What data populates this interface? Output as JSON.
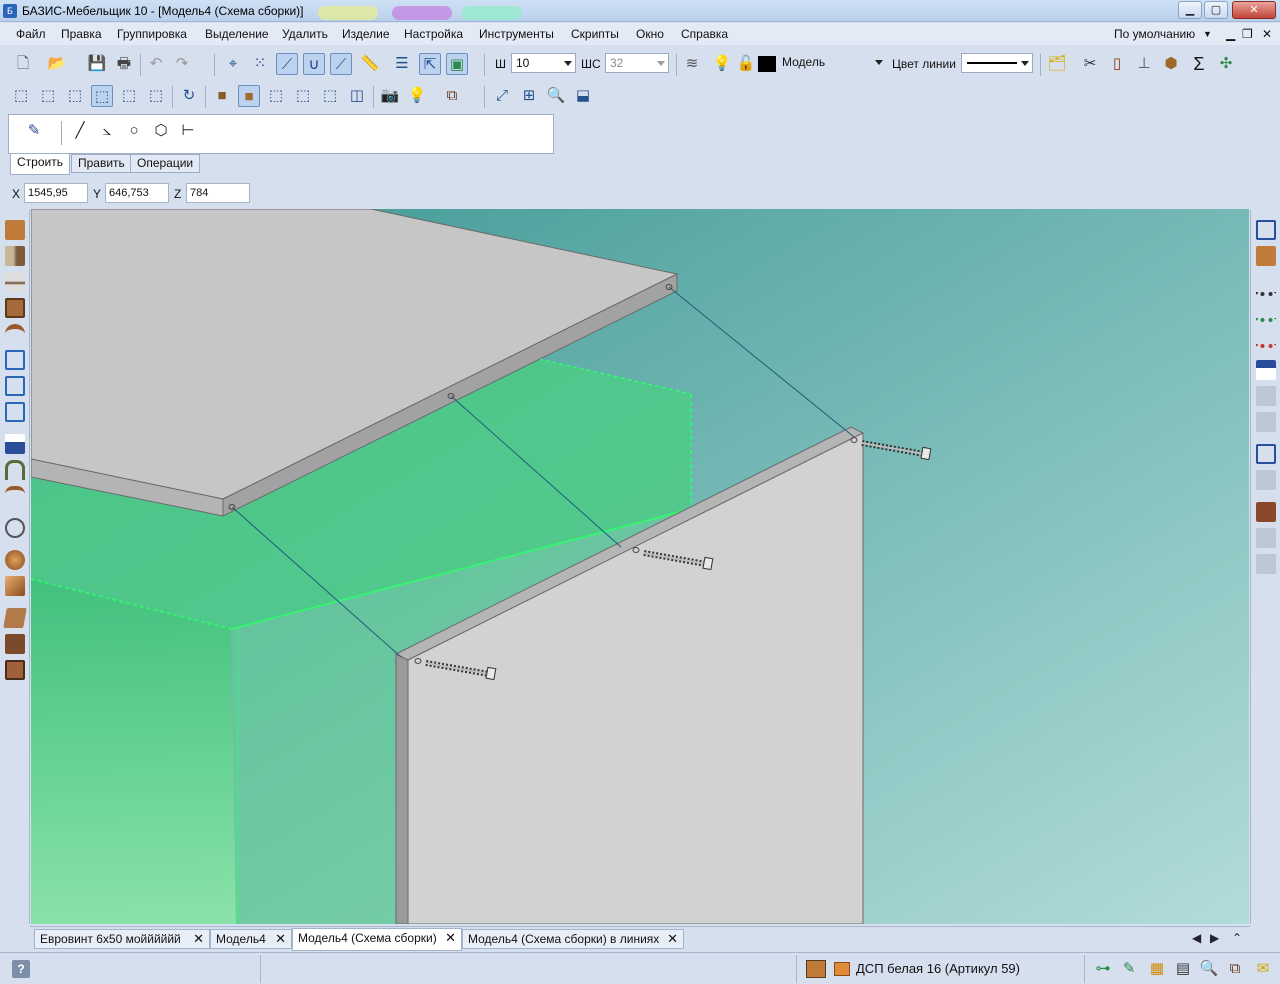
{
  "window": {
    "title": "БАЗИС-Мебельщик 10 - [Модель4 (Схема сборки)]",
    "min": "▁",
    "max": "▢",
    "close": "✕"
  },
  "menu": {
    "items": [
      "Файл",
      "Правка",
      "Группировка",
      "Выделение",
      "Удалить",
      "Изделие",
      "Настройка",
      "Инструменты",
      "Скрипты",
      "Окно",
      "Справка"
    ],
    "profile": "По умолчанию",
    "mdi_min": "▁",
    "mdi_restore": "❐",
    "mdi_close": "✕"
  },
  "toolbar": {
    "width_label": "Ш",
    "width_value": "10",
    "step_label": "ШС",
    "step_value": "32",
    "layer_value": "Модель",
    "line_color_label": "Цвет линии"
  },
  "build": {
    "tabs": [
      "Строить",
      "Править",
      "Операции"
    ]
  },
  "coords": {
    "x_label": "X",
    "x_value": "1545,95",
    "y_label": "Y",
    "y_value": "646,753",
    "z_label": "Z",
    "z_value": "784"
  },
  "doc_tabs": [
    {
      "label": "Евровинт 6х50 мойййййй",
      "close": "✕"
    },
    {
      "label": "Модель4",
      "close": "✕"
    },
    {
      "label": "Модель4 (Схема сборки)",
      "close": "✕"
    },
    {
      "label": "Модель4 (Схема сборки) в линиях",
      "close": "✕"
    }
  ],
  "doc_nav": {
    "left": "◀",
    "right": "▶",
    "up": "⌃"
  },
  "status": {
    "help": "?",
    "material": "ДСП белая 16 (Артикул 59)"
  },
  "colors": {
    "accent": "#2a65b8",
    "viewport_top": "#3d9a96",
    "viewport_bottom": "#aad4d1",
    "panel_green": "#4fd08a",
    "board_grey": "#c9c9c9"
  }
}
